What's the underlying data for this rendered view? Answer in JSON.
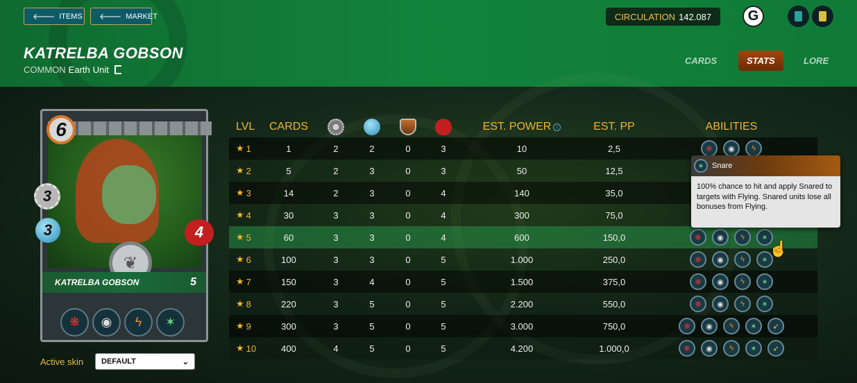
{
  "nav": {
    "items_label": "ITEMS",
    "market_label": "MARKET"
  },
  "circulation": {
    "label": "CIRCULATION",
    "value": "142.087"
  },
  "card_info": {
    "name": "KATRELBA GOBSON",
    "rarity": "COMMON",
    "element": "Earth",
    "type": "Unit"
  },
  "tabs": [
    {
      "label": "CARDS",
      "active": false
    },
    {
      "label": "STATS",
      "active": true
    },
    {
      "label": "LORE",
      "active": false
    }
  ],
  "card": {
    "mana": "6",
    "melee": "3",
    "speed": "3",
    "health": "4",
    "name": "KATRELBA GOBSON",
    "level": "5",
    "abilities": [
      "rage-icon",
      "helmet-icon",
      "lightning-icon",
      "snare-icon"
    ]
  },
  "skin": {
    "label": "Active skin",
    "selected": "DEFAULT"
  },
  "table": {
    "headers": {
      "lvl": "LVL",
      "cards": "CARDS",
      "attack": "melee-attack-icon",
      "speed": "speed-icon",
      "armor": "armor-icon",
      "health": "health-icon",
      "est_power": "EST. POWER",
      "est_pp": "EST. PP",
      "abilities": "ABILITIES"
    },
    "rows": [
      {
        "lvl": "1",
        "cards": "1",
        "attack": "2",
        "speed": "2",
        "armor": "0",
        "health": "3",
        "power": "10",
        "pp": "2,5",
        "abilities": [
          "rage-icon",
          "helmet-icon",
          "lightning-icon"
        ]
      },
      {
        "lvl": "2",
        "cards": "5",
        "attack": "2",
        "speed": "3",
        "armor": "0",
        "health": "3",
        "power": "50",
        "pp": "12,5",
        "abilities": []
      },
      {
        "lvl": "3",
        "cards": "14",
        "attack": "2",
        "speed": "3",
        "armor": "0",
        "health": "4",
        "power": "140",
        "pp": "35,0",
        "abilities": []
      },
      {
        "lvl": "4",
        "cards": "30",
        "attack": "3",
        "speed": "3",
        "armor": "0",
        "health": "4",
        "power": "300",
        "pp": "75,0",
        "abilities": []
      },
      {
        "lvl": "5",
        "cards": "60",
        "attack": "3",
        "speed": "3",
        "armor": "0",
        "health": "4",
        "power": "600",
        "pp": "150,0",
        "abilities": [
          "rage-icon",
          "helmet-icon",
          "lightning-icon",
          "snare-icon"
        ]
      },
      {
        "lvl": "6",
        "cards": "100",
        "attack": "3",
        "speed": "3",
        "armor": "0",
        "health": "5",
        "power": "1.000",
        "pp": "250,0",
        "abilities": [
          "rage-icon",
          "helmet-icon",
          "lightning-icon",
          "snare-icon"
        ]
      },
      {
        "lvl": "7",
        "cards": "150",
        "attack": "3",
        "speed": "4",
        "armor": "0",
        "health": "5",
        "power": "1.500",
        "pp": "375,0",
        "abilities": [
          "rage-icon",
          "helmet-icon",
          "lightning-icon",
          "snare-icon"
        ]
      },
      {
        "lvl": "8",
        "cards": "220",
        "attack": "3",
        "speed": "5",
        "armor": "0",
        "health": "5",
        "power": "2.200",
        "pp": "550,0",
        "abilities": [
          "rage-icon",
          "helmet-icon",
          "lightning-icon",
          "snare-icon"
        ]
      },
      {
        "lvl": "9",
        "cards": "300",
        "attack": "3",
        "speed": "5",
        "armor": "0",
        "health": "5",
        "power": "3.000",
        "pp": "750,0",
        "abilities": [
          "rage-icon",
          "helmet-icon",
          "lightning-icon",
          "snare-icon",
          "reflex-icon"
        ]
      },
      {
        "lvl": "10",
        "cards": "400",
        "attack": "4",
        "speed": "5",
        "armor": "0",
        "health": "5",
        "power": "4.200",
        "pp": "1.000,0",
        "abilities": [
          "rage-icon",
          "helmet-icon",
          "lightning-icon",
          "snare-icon",
          "reflex-icon"
        ]
      }
    ]
  },
  "tooltip": {
    "title": "Snare",
    "text": "100% chance to hit and apply Snared to targets with Flying. Snared units lose all bonuses from Flying."
  },
  "colors": {
    "accent_gold": "#f2b531",
    "header_green": "#13833c",
    "active_tab": "#a0460c"
  }
}
